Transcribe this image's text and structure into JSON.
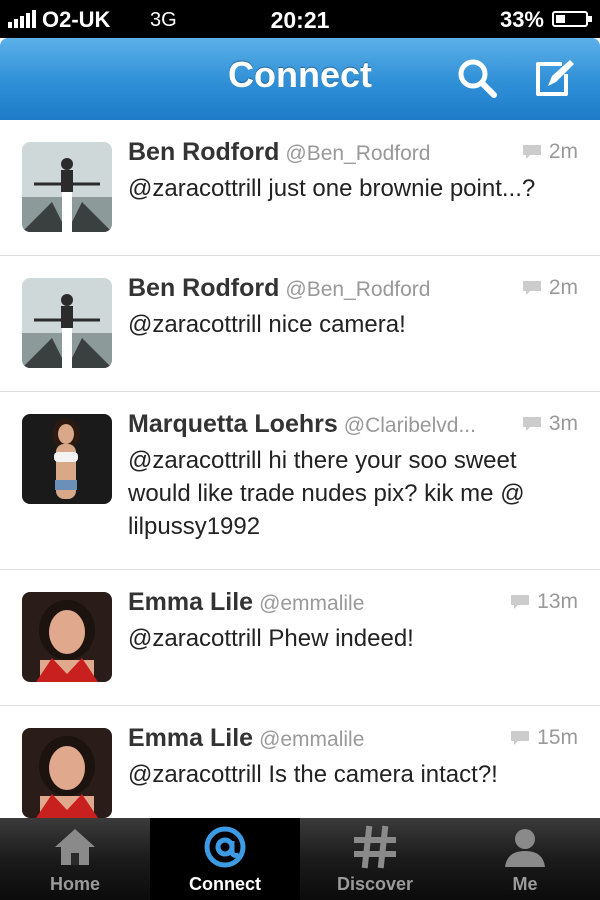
{
  "status_bar": {
    "carrier": "O2-UK",
    "network": "3G",
    "time": "20:21",
    "battery": "33%"
  },
  "nav": {
    "title": "Connect"
  },
  "tweets": [
    {
      "name": "Ben Rodford",
      "handle": "@Ben_Rodford",
      "time": "2m",
      "text": "@zaracottrill just one brownie point...?"
    },
    {
      "name": "Ben Rodford",
      "handle": "@Ben_Rodford",
      "time": "2m",
      "text": "@zaracottrill nice camera!"
    },
    {
      "name": "Marquetta Loehrs",
      "handle": "@Claribelvd...",
      "time": "3m",
      "text": "@zaracottrill hi there your soo sweet would like trade nudes pix? kik me @ lilpussy1992"
    },
    {
      "name": "Emma Lile",
      "handle": "@emmalile",
      "time": "13m",
      "text": "@zaracottrill Phew indeed!"
    },
    {
      "name": "Emma Lile",
      "handle": "@emmalile",
      "time": "15m",
      "text": "@zaracottrill Is the camera intact?!"
    }
  ],
  "tabs": [
    {
      "label": "Home",
      "icon": "home-icon"
    },
    {
      "label": "Connect",
      "icon": "at-icon"
    },
    {
      "label": "Discover",
      "icon": "hashtag-icon"
    },
    {
      "label": "Me",
      "icon": "person-icon"
    }
  ],
  "colors": {
    "nav_blue": "#2f8fd6",
    "tab_active": "#2f8fd6"
  }
}
